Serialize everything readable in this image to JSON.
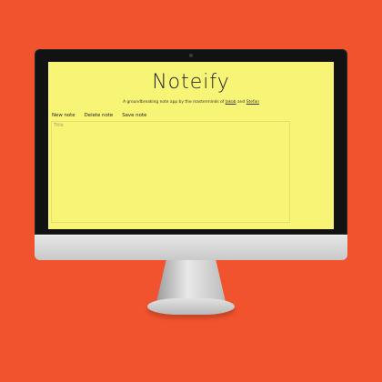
{
  "app": {
    "title": "Noteify",
    "subtitle_prefix": "A groundbreaking note app by the masterminds of",
    "author_1": "Jakob",
    "subtitle_joiner": "and",
    "author_2": "Stefan"
  },
  "toolbar": {
    "new_note": "New note",
    "delete_note": "Delete note",
    "save_note": "Save note"
  },
  "editor": {
    "title_placeholder": "Title"
  },
  "colors": {
    "background": "#f0532e",
    "screen": "#f8f576"
  }
}
